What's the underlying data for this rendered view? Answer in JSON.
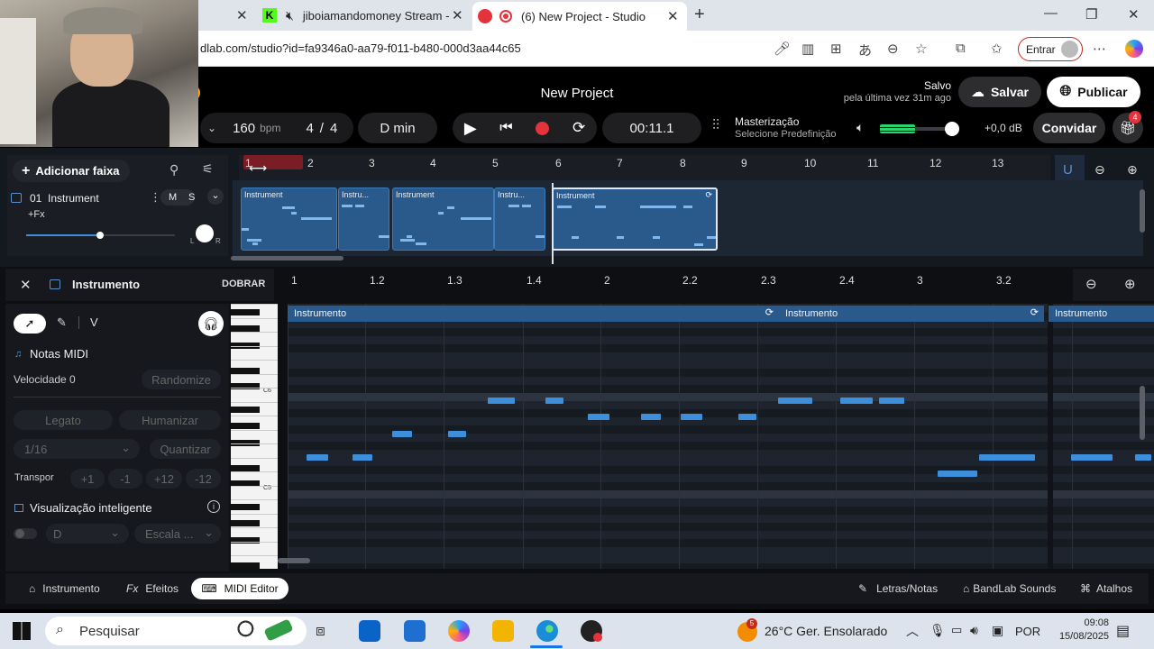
{
  "browser": {
    "tabs": [
      {
        "title": "jiboiamandomoney Stream -"
      },
      {
        "title": "(6) New Project - Studio"
      }
    ],
    "url": "dlab.com/studio?id=fa9346a0-aa79-f011-b480-000d3aa44c65",
    "signin_label": "Entrar"
  },
  "studio": {
    "project_title": "New Project",
    "saved_line1": "Salvo",
    "saved_line2": "pela última vez 31m ago",
    "save_label": "Salvar",
    "publish_label": "Publicar",
    "bpm_value": "160",
    "bpm_unit": "bpm",
    "meter_num": "4",
    "meter_den": "4",
    "key": "D min",
    "time": "00:11.1",
    "mastering_title": "Masterização",
    "mastering_sub": "Selecione Predefinição",
    "volume_db": "+0,0 dB",
    "volume_level": 0.45,
    "invite_label": "Convidar",
    "gift_count": "4",
    "accent_color": "#2a5a8c",
    "record_color": "#e5323b"
  },
  "tracks": {
    "add_label": "Adicionar faixa",
    "ruler": [
      "1",
      "2",
      "3",
      "4",
      "5",
      "6",
      "7",
      "8",
      "9",
      "10",
      "11",
      "12",
      "13"
    ],
    "track": {
      "number": "01",
      "name": "Instrument",
      "fx_label": "+Fx",
      "mute": "M",
      "solo": "S",
      "pan_l": "L",
      "pan_r": "R",
      "volume_level": 0.55
    },
    "clips": [
      {
        "label": "Instrument"
      },
      {
        "label": "Instru..."
      },
      {
        "label": "Instrument"
      },
      {
        "label": "Instru..."
      },
      {
        "label": "Instrument"
      }
    ]
  },
  "editor": {
    "title": "Instrumento",
    "fold_label": "DOBRAR",
    "tool_v": "V",
    "midi_notes_label": "Notas MIDI",
    "velocity_label": "Velocidade 0",
    "randomize_label": "Randomize",
    "legato_label": "Legato",
    "humanize_label": "Humanizar",
    "quantize_value": "1/16",
    "quantize_label": "Quantizar",
    "transpose_label": "Transpor",
    "transpose_buttons": [
      "+1",
      "-1",
      "+12",
      "-12"
    ],
    "smart_view_label": "Visualização inteligente",
    "key_select": "D",
    "scale_select": "Escala ...",
    "c6_label": "C6",
    "c5_label": "C5",
    "ruler": [
      "1",
      "1.2",
      "1.3",
      "1.4",
      "2",
      "2.2",
      "2.3",
      "2.4",
      "3",
      "3.2"
    ],
    "regions": [
      {
        "label": "Instrumento"
      },
      {
        "label": "Instrumento"
      },
      {
        "label": "Instrumento"
      }
    ]
  },
  "bottom": {
    "tab_instrument": "Instrumento",
    "tab_effects": "Efeitos",
    "tab_midi": "MIDI Editor",
    "lyrics_label": "Letras/Notas",
    "sounds_label": "BandLab Sounds",
    "shortcuts_label": "Atalhos"
  },
  "taskbar": {
    "search_placeholder": "Pesquisar",
    "weather": "26°C Ger. Ensolarado",
    "weather_badge": "5",
    "lang": "POR",
    "time": "09:08",
    "date": "15/08/2025"
  }
}
